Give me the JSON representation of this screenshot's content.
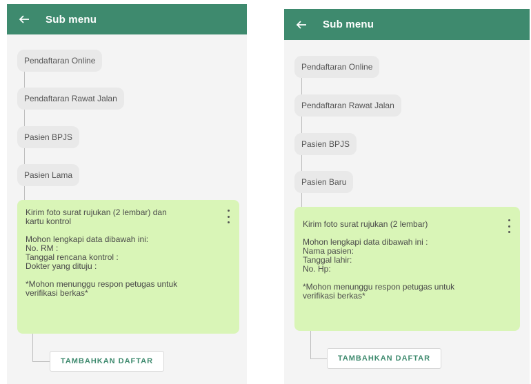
{
  "colors": {
    "appbar": "#3e8a6e",
    "background": "#f4f4f4",
    "chip": "#e9e9e9",
    "card": "#d9f5b7",
    "button_text": "#3e8a6e"
  },
  "left": {
    "header": {
      "back_icon": "arrow-left-icon",
      "title": "Sub menu"
    },
    "items": [
      {
        "label": "Pendaftaran Online"
      },
      {
        "label": "Pendaftaran Rawat Jalan"
      },
      {
        "label": "Pasien BPJS"
      },
      {
        "label": "Pasien Lama"
      }
    ],
    "card": {
      "line1": "Kirim foto surat rujukan (2 lembar) dan\nkartu kontrol",
      "line2": "Mohon lengkapi data dibawah ini:\nNo. RM :\nTanggal rencana kontrol :\nDokter yang dituju :",
      "line3": "*Mohon menunggu respon petugas untuk\nverifikasi berkas*",
      "menu_icon": "more-vertical-icon"
    },
    "add_button": "TAMBAHKAN DAFTAR"
  },
  "right": {
    "header": {
      "back_icon": "arrow-left-icon",
      "title": "Sub menu"
    },
    "items": [
      {
        "label": "Pendaftaran Online"
      },
      {
        "label": "Pendaftaran Rawat Jalan"
      },
      {
        "label": "Pasien BPJS"
      },
      {
        "label": "Pasien Baru"
      }
    ],
    "card": {
      "line1": "Kirim foto surat rujukan (2 lembar)",
      "line2": "Mohon lengkapi data dibawah ini :\nNama pasien:\nTanggal lahir:\nNo. Hp:",
      "line3": "*Mohon menunggu respon petugas untuk\nverifikasi berkas*",
      "menu_icon": "more-vertical-icon"
    },
    "add_button": "TAMBAHKAN DAFTAR"
  }
}
